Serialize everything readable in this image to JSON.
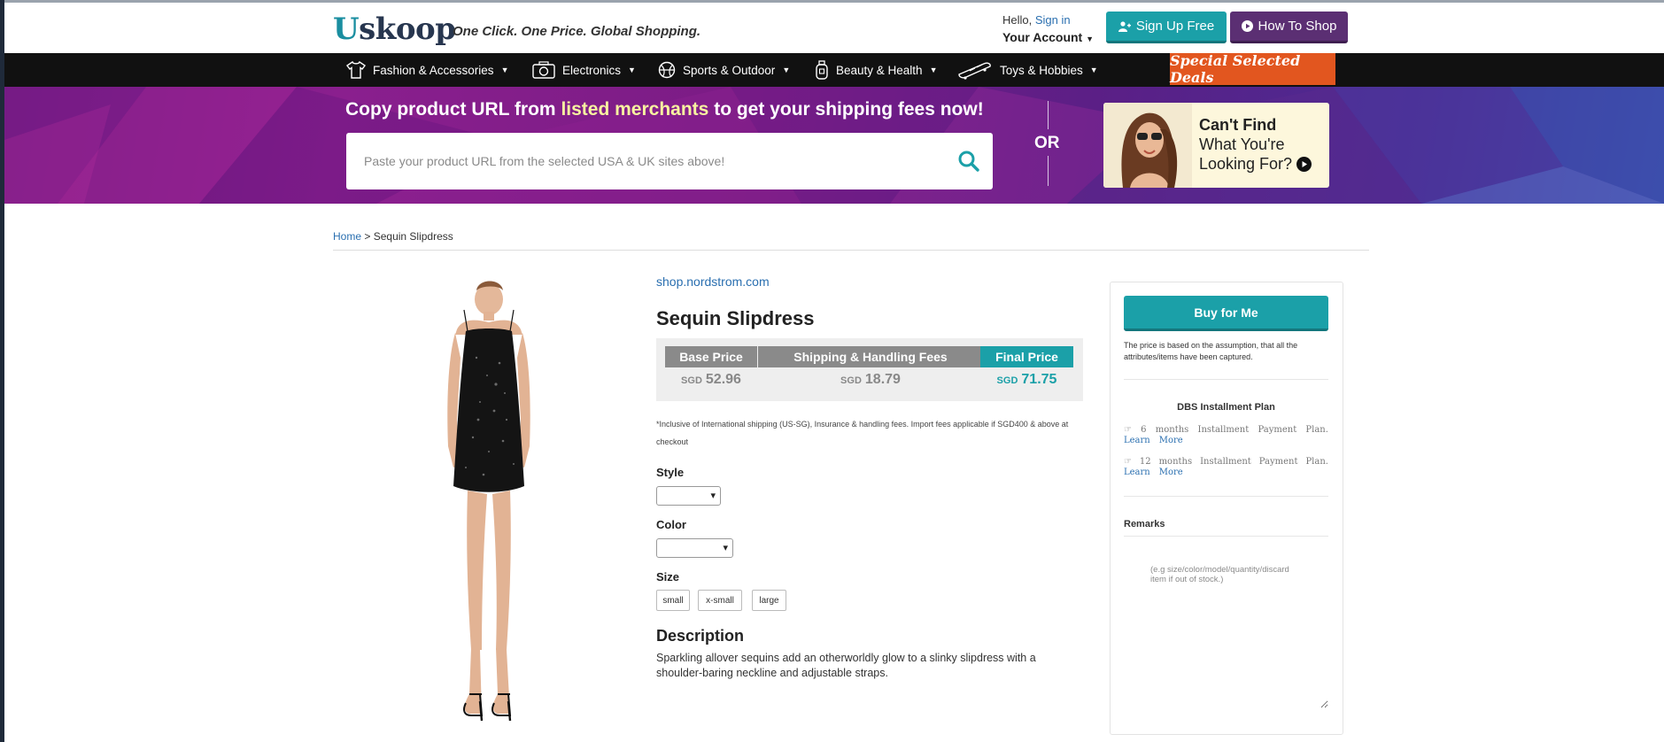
{
  "header": {
    "logo_first": "U",
    "logo_rest": "skoop",
    "tagline": "One Click. One Price. Global Shopping.",
    "hello_prefix": "Hello,",
    "sign_in": "Sign in",
    "account": "Your Account",
    "signup_label": "Sign Up Free",
    "howto_label": "How To Shop"
  },
  "nav": {
    "items": [
      {
        "label": "Fashion & Accessories",
        "icon": "tshirt-icon"
      },
      {
        "label": "Electronics",
        "icon": "camera-icon"
      },
      {
        "label": "Sports & Outdoor",
        "icon": "basketball-icon"
      },
      {
        "label": "Beauty & Health",
        "icon": "lotion-bottle-icon"
      },
      {
        "label": "Toys & Hobbies",
        "icon": "skateboard-icon"
      }
    ],
    "deals_label": "Special Selected Deals"
  },
  "banner": {
    "title_part1": "Copy product URL from",
    "title_highlight": "listed merchants",
    "title_part2": "to get your shipping fees now!",
    "search_placeholder": "Paste your product URL from the selected USA & UK sites above!",
    "or_label": "OR",
    "cantfind_line1": "Can't Find",
    "cantfind_line2": "What You're",
    "cantfind_line3": "Looking For?"
  },
  "breadcrumb": {
    "home": "Home",
    "separator": ">",
    "current": "Sequin Slipdress"
  },
  "product": {
    "merchant": "shop.nordstrom.com",
    "title": "Sequin Slipdress",
    "price_headers": {
      "base": "Base Price",
      "shipping": "Shipping & Handling Fees",
      "final": "Final Price"
    },
    "currency": "SGD",
    "base_price": "52.96",
    "shipping_price": "18.79",
    "final_price": "71.75",
    "footnote": "*Inclusive of International shipping (US-SG), Insurance & handling fees. Import fees applicable if SGD400 & above at checkout",
    "style_label": "Style",
    "color_label": "Color",
    "size_label": "Size",
    "sizes": [
      "small",
      "x-small",
      "large"
    ],
    "description_heading": "Description",
    "description": "Sparkling allover sequins add an otherworldly glow to a slinky slipdress with a shoulder-baring neckline and adjustable straps."
  },
  "panel": {
    "buy_label": "Buy for Me",
    "assumption": "The price is based on the assumption, that all the attributes/items have been captured.",
    "dbs_title": "DBS Installment Plan",
    "installments": [
      {
        "months": "6",
        "word1": "months",
        "word2": "Installment",
        "word3": "Payment",
        "word4": "Plan.",
        "learn": "Learn",
        "more": "More"
      },
      {
        "months": "12",
        "word1": "months",
        "word2": "Installment",
        "word3": "Payment",
        "word4": "Plan.",
        "learn": "Learn",
        "more": "More"
      }
    ],
    "remarks_label": "Remarks",
    "remarks_placeholder": "(e.g size/color/model/quantity/discard item if out of stock.)"
  },
  "colors": {
    "teal": "#1ba0a8",
    "purple": "#5b2f73",
    "deals_orange": "#e2561f",
    "link_blue": "#2a6fb0"
  }
}
